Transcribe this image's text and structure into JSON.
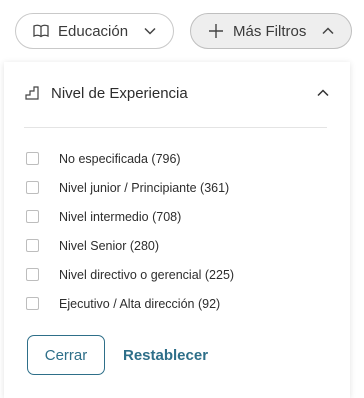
{
  "filters": {
    "education": {
      "label": "Educación",
      "icon": "book-icon"
    },
    "more": {
      "label": "Más Filtros",
      "icon": "plus-icon"
    }
  },
  "panel": {
    "section": {
      "title": "Nivel de Experiencia",
      "icon": "stairs-icon",
      "options": [
        {
          "label": "No especificada (796)",
          "checked": false
        },
        {
          "label": "Nivel junior / Principiante (361)",
          "checked": false
        },
        {
          "label": "Nivel intermedio (708)",
          "checked": false
        },
        {
          "label": "Nivel Senior (280)",
          "checked": false
        },
        {
          "label": "Nivel directivo o gerencial (225)",
          "checked": false
        },
        {
          "label": "Ejecutivo / Alta dirección (92)",
          "checked": false
        }
      ]
    },
    "actions": {
      "close_label": "Cerrar",
      "reset_label": "Restablecer"
    }
  },
  "colors": {
    "accent": "#2e6f89",
    "pill_active_bg": "#eeeeee",
    "border": "#c9c9c9"
  }
}
